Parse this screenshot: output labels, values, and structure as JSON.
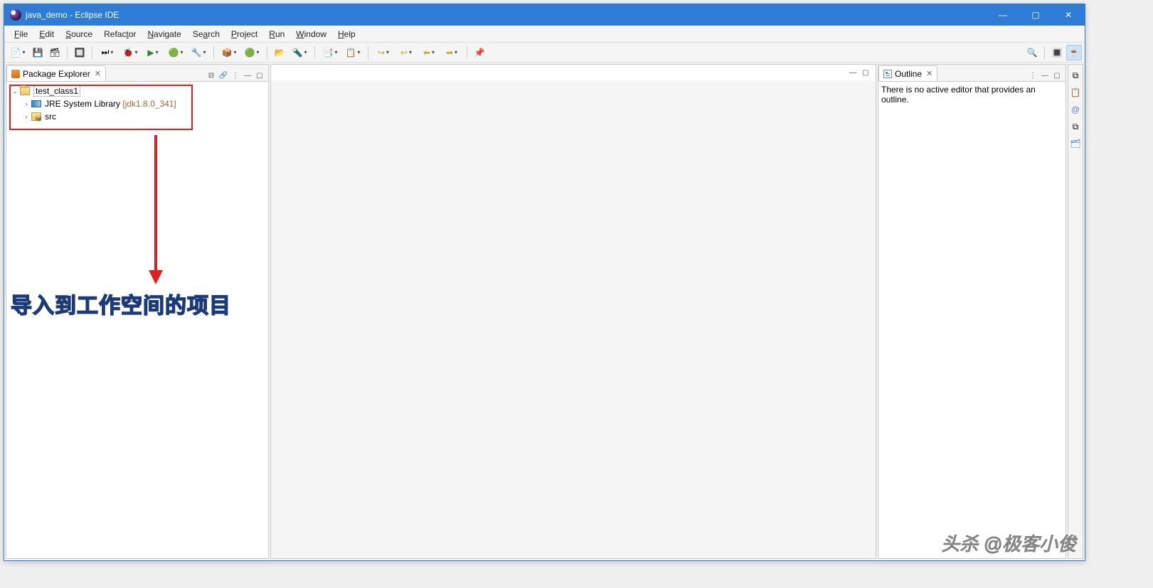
{
  "title": "java_demo - Eclipse IDE",
  "menus": [
    "File",
    "Edit",
    "Source",
    "Refactor",
    "Navigate",
    "Search",
    "Project",
    "Run",
    "Window",
    "Help"
  ],
  "menu_underline_idx": [
    0,
    0,
    0,
    4,
    0,
    2,
    0,
    0,
    0,
    0
  ],
  "package_explorer": {
    "title": "Package Explorer",
    "tree": {
      "project": "test_class1",
      "jre_label": "JRE System Library",
      "jre_version": "[jdk1.8.0_341]",
      "src": "src"
    }
  },
  "outline": {
    "title": "Outline",
    "empty_msg": "There is no active editor that provides an outline."
  },
  "annotation": "导入到工作空间的项目",
  "watermark": "头杀 @极客小俊"
}
